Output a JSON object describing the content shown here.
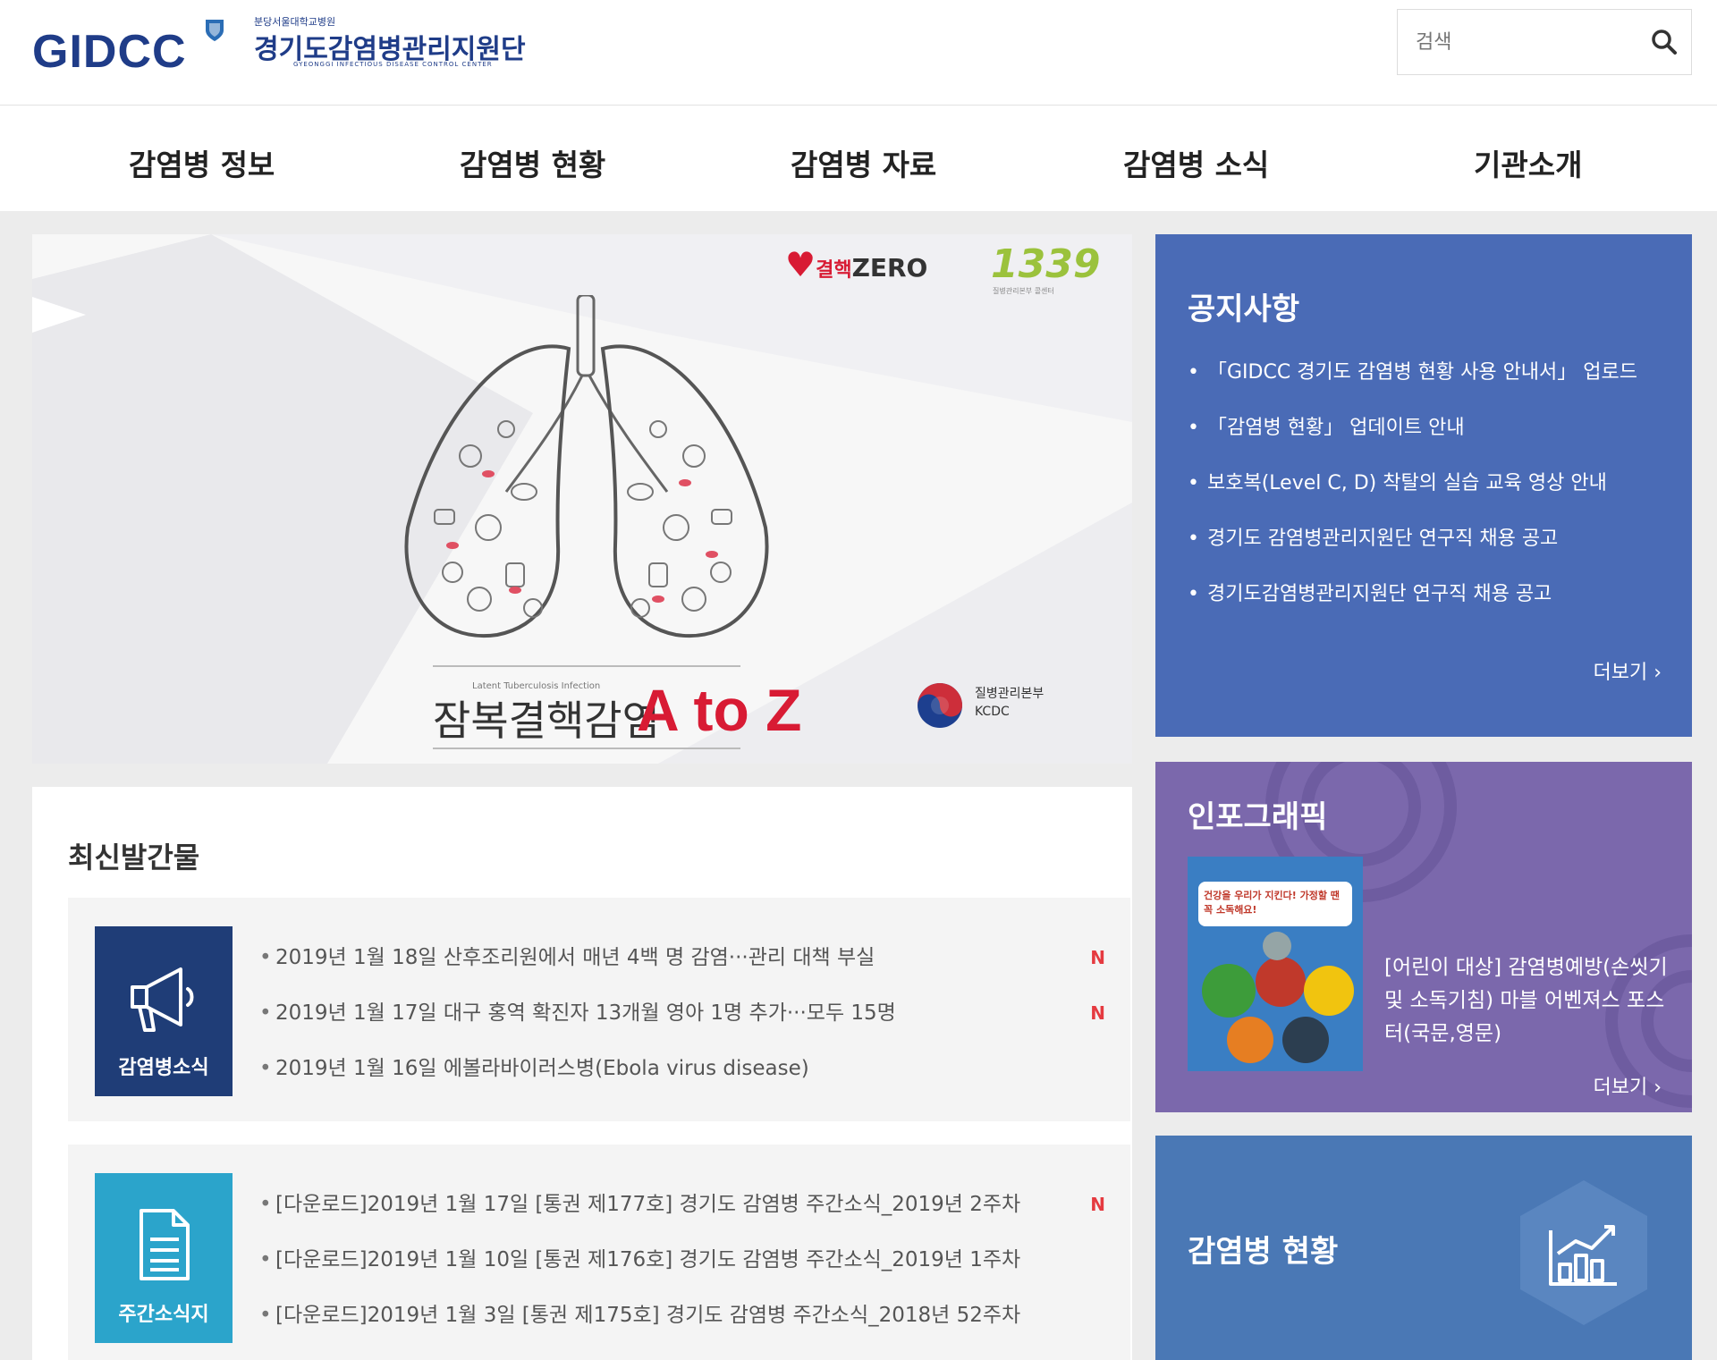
{
  "header": {
    "logo_mark": "GIDCC",
    "logo_sub": "분당서울대학교병원",
    "logo_name": "경기도감염병관리지원단",
    "logo_en": "GYEONGGI INFECTIOUS DISEASE CONTROL CENTER",
    "search_placeholder": "검색"
  },
  "nav": {
    "items": [
      "감염병 정보",
      "감염병 현황",
      "감염병 자료",
      "감염병 소식",
      "기관소개"
    ]
  },
  "banner": {
    "badge_zero": "ZERO",
    "badge_zero_g": "결핵",
    "badge_1339": "1339",
    "badge_1339_sub": "질병관리본부 콜센터",
    "subtitle_small": "Latent Tuberculosis Infection",
    "title": "잠복결핵감염",
    "title_az": "A to Z",
    "kcdc_kr": "질병관리본부",
    "kcdc_en": "KCDC"
  },
  "publications": {
    "title": "최신발간물",
    "news": {
      "label": "감염병소식",
      "items": [
        {
          "text": "2019년 1월 18일 산후조리원에서 매년 4백 명 감염···관리 대책 부실",
          "new": "N"
        },
        {
          "text": "2019년 1월 17일 대구 홍역 확진자 13개월 영아 1명 추가···모두 15명",
          "new": "N"
        },
        {
          "text": "2019년 1월 16일 에볼라바이러스병(Ebola virus disease)",
          "new": ""
        }
      ]
    },
    "weekly": {
      "label": "주간소식지",
      "items": [
        {
          "text": "[다운로드]2019년 1월 17일 [통권 제177호] 경기도 감염병 주간소식_2019년 2주차",
          "new": "N"
        },
        {
          "text": "[다운로드]2019년 1월 10일 [통권 제176호] 경기도 감염병 주간소식_2019년 1주차",
          "new": ""
        },
        {
          "text": "[다운로드]2019년 1월 3일 [통권 제175호] 경기도 감염병 주간소식_2018년 52주차",
          "new": ""
        }
      ]
    }
  },
  "notice": {
    "title": "공지사항",
    "items": [
      "「GIDCC 경기도 감염병 현황 사용 안내서」 업로드",
      "「감염병 현황」 업데이트 안내",
      "보호복(Level C, D) 착탈의 실습 교육 영상 안내",
      "경기도 감염병관리지원단 연구직 채용 공고",
      "경기도감염병관리지원단 연구직 채용 공고"
    ],
    "more": "더보기 ›"
  },
  "infographic": {
    "title": "인포그래픽",
    "poster_text": "건강을 우리가 지킨다! 가정할 땐 꼭 소독해요!",
    "desc": "[어린이 대상] 감염병예방(손씻기 및 소독기침) 마블 어벤져스 포스터(국문,영문)",
    "more": "더보기 ›"
  },
  "status": {
    "title": "감염병 현황"
  },
  "colors": {
    "brand": "#1f3c88",
    "notice_bg": "#4a6bb6",
    "info_bg": "#7b68ac",
    "status_bg": "#4a78b5",
    "news_icon_bg": "#1f3d77",
    "weekly_icon_bg": "#2ba4cb",
    "new_badge": "#e53a40",
    "banner_accent": "#d81b34"
  },
  "icons": {
    "search": "search-icon",
    "megaphone": "megaphone-icon",
    "document": "document-icon",
    "chart": "bar-chart-icon"
  }
}
